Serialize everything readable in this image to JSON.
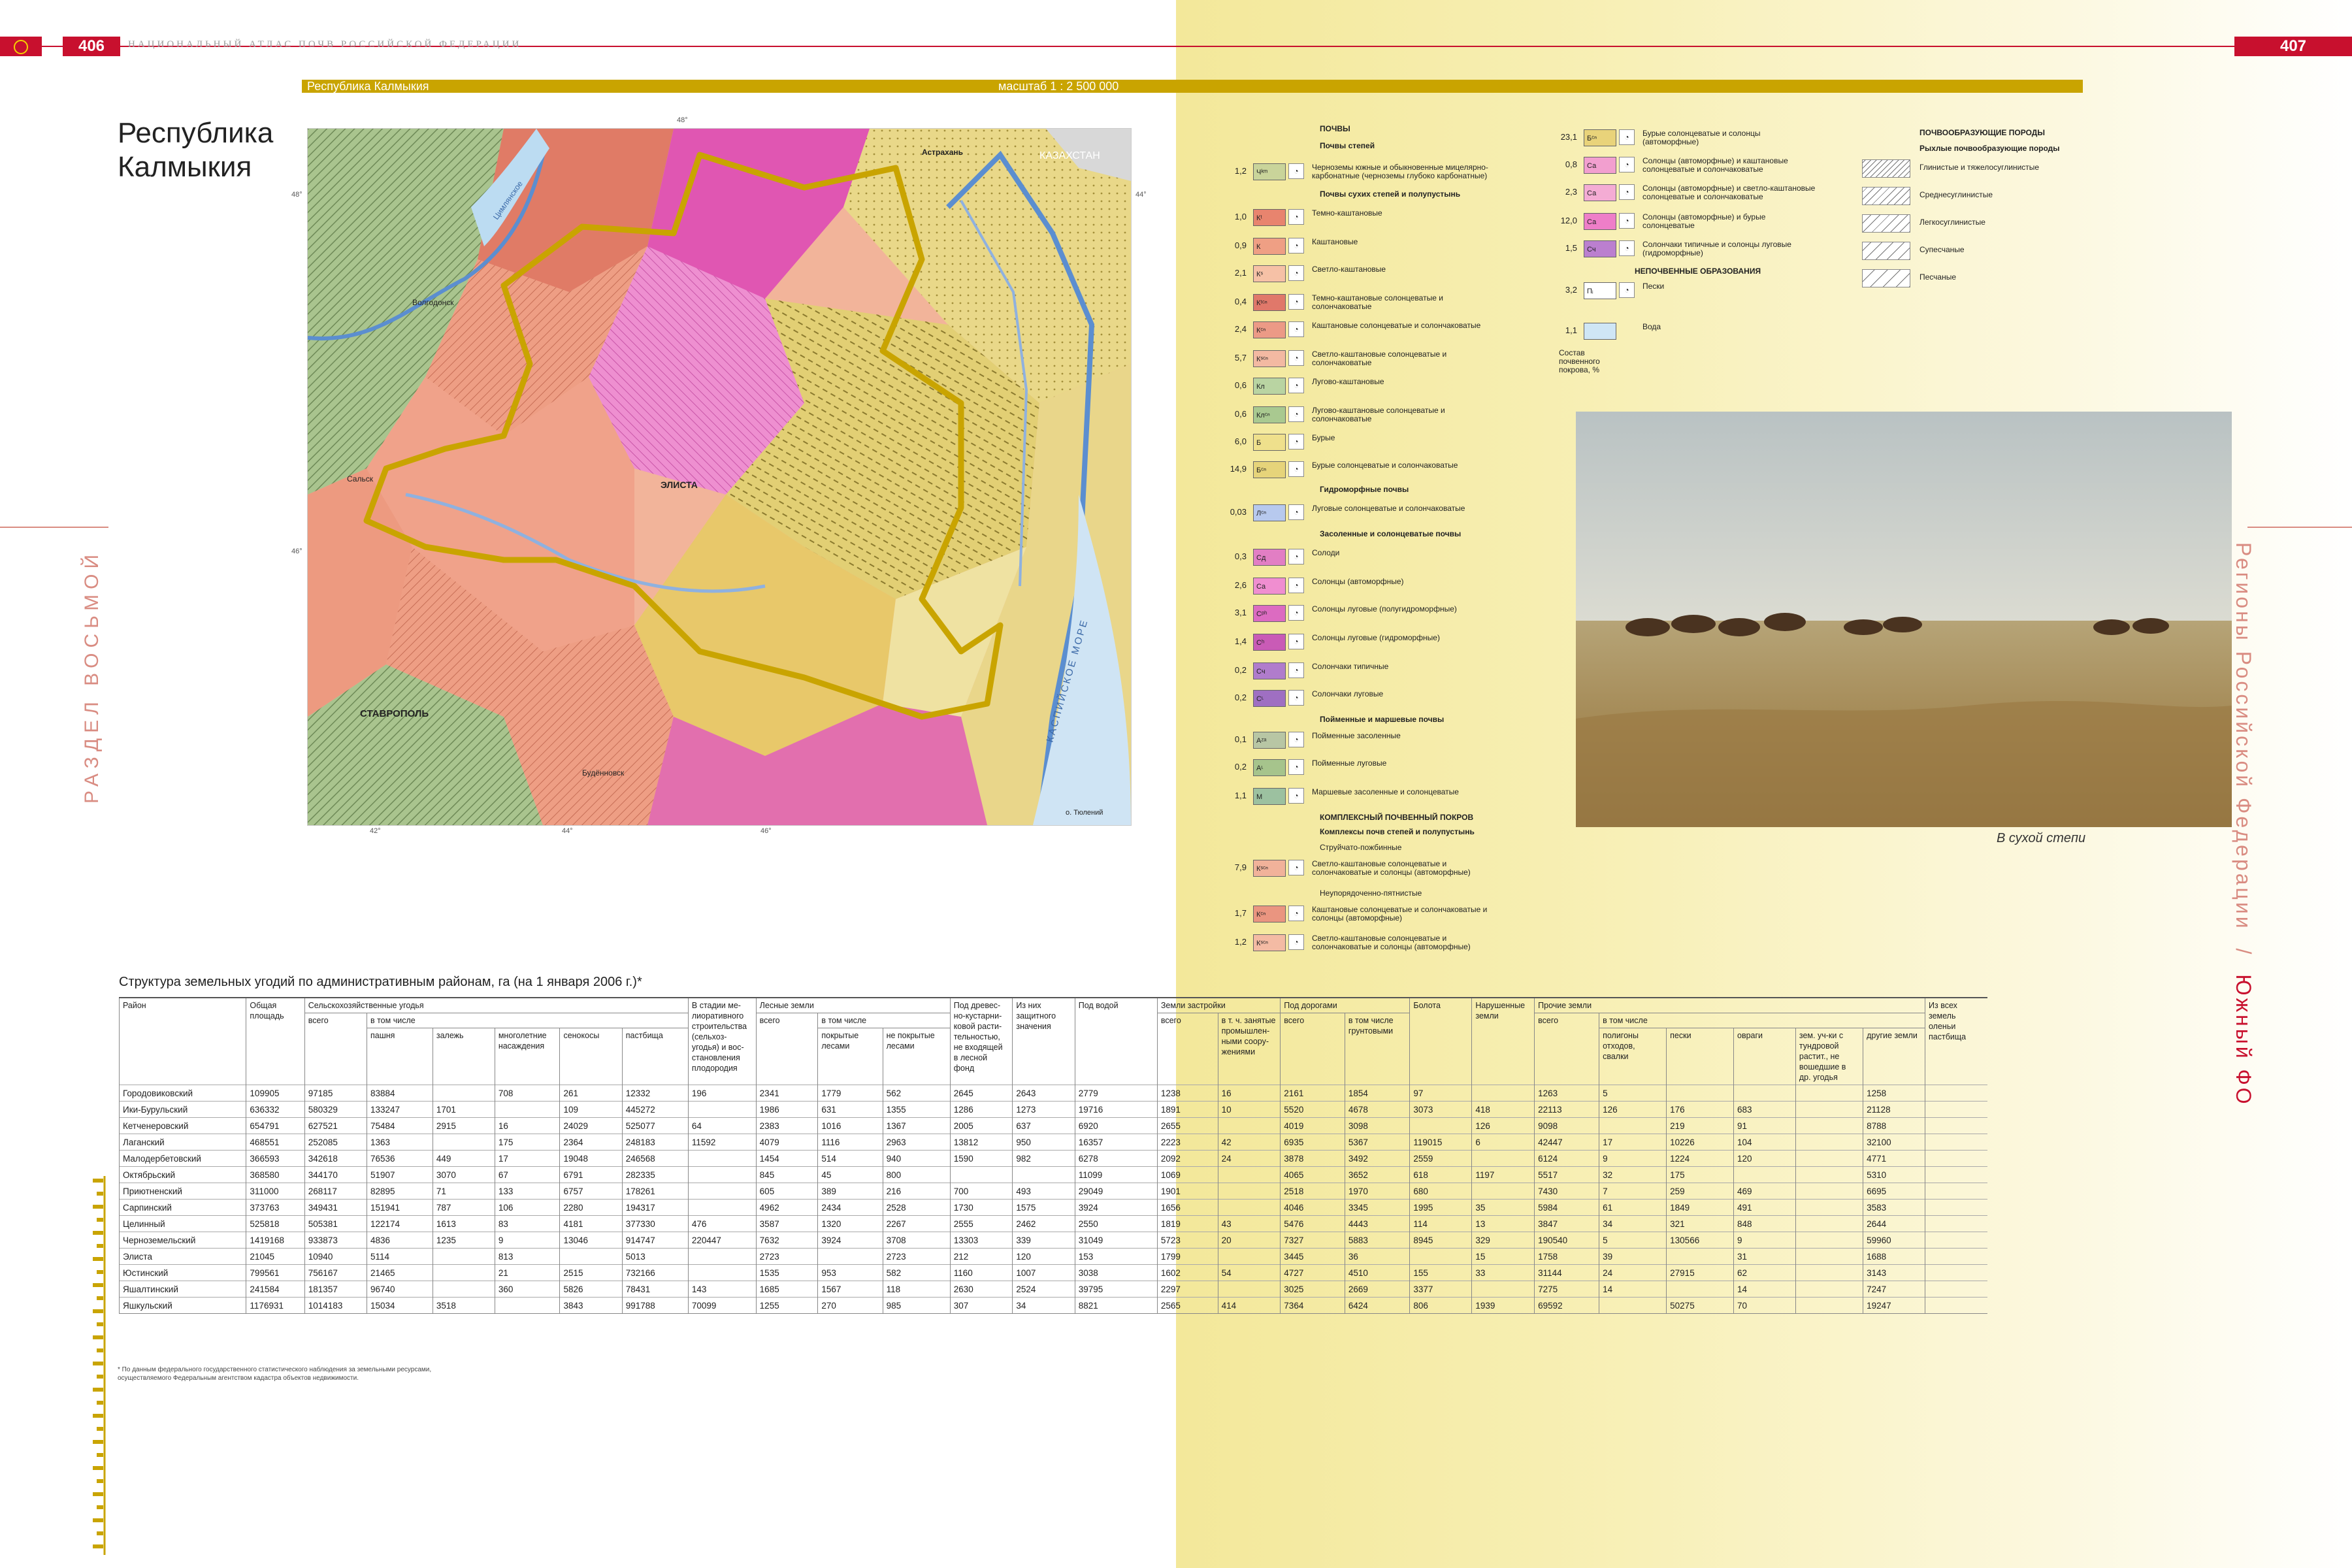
{
  "header": {
    "page_left": "406",
    "page_right": "407",
    "atlas_title": "НАЦИОНАЛЬНЫЙ АТЛАС ПОЧВ РОССИЙСКОЙ ФЕДЕРАЦИИ"
  },
  "map_bar": {
    "region": "Республика Калмыкия",
    "scale": "масштаб 1 : 2 500 000"
  },
  "title": {
    "line1": "Республика",
    "line2": "Калмыкия"
  },
  "side": {
    "left": "РАЗДЕЛ ВОСЬМОЙ",
    "right_a": "Регионы Российской Федерации",
    "sep": "/",
    "right_b": "Южный ФО"
  },
  "map_labels": {
    "kazakhstan": "КАЗАХСТАН",
    "sea": "КАСПИЙСКОЕ МОРЕ",
    "elista": "ЭЛИСТА",
    "stavropol": "СТАВРОПОЛЬ",
    "volgodonsk": "Волгодонск",
    "astrakhan": "Астрахань",
    "sal": "Сальск",
    "budennovsk": "Будённовск",
    "reservoir": "Цимлянское",
    "island": "о. Тюлений",
    "lon1": "42°",
    "lon2": "44°",
    "lon3": "46°",
    "lon4": "48°",
    "lat1": "48°",
    "lat2": "46°",
    "lat3": "44°"
  },
  "legend": {
    "col1_title": "ПОЧВЫ",
    "g_steppe": "Почвы степей",
    "g_dry": "Почвы сухих степей и полупустынь",
    "g_hydro": "Гидроморфные почвы",
    "g_saline": "Засоленные и солонцеватые почвы",
    "g_flood": "Пойменные и маршевые почвы",
    "g_complex": "КОМПЛЕКСНЫЙ ПОЧВЕННЫЙ ПОКРОВ",
    "g_complex_sub": "Комплексы почв степей и полупустынь",
    "g_stream": "Струйчато-пожбинные",
    "g_spot": "Неупорядоченно-пятнистые",
    "col2_nonsoil": "НЕПОЧВЕННЫЕ ОБРАЗОВАНИЯ",
    "composition_note": "Состав почвенного покрова, %",
    "col3_title": "ПОЧВООБРАЗУЮЩИЕ ПОРОДЫ",
    "col3_sub": "Рыхлые почвообразующие породы",
    "items1": [
      {
        "pct": "1,2",
        "code": "Чᵏᵐ",
        "color": "#c9d49a",
        "label": "Черноземы южные и обыкновенные мицелярно-карбонатные (черноземы глубоко карбонатные)"
      },
      {
        "pct": "1,0",
        "code": "Кᵗ",
        "color": "#e8846e",
        "label": "Темно-каштановые"
      },
      {
        "pct": "0,9",
        "code": "К",
        "color": "#ef9f84",
        "label": "Каштановые"
      },
      {
        "pct": "2,1",
        "code": "Кˢ",
        "color": "#f6c1a6",
        "label": "Светло-каштановые"
      },
      {
        "pct": "0,4",
        "code": "Кᵗᶜⁿ",
        "color": "#e0786a",
        "label": "Темно-каштановые солонцеватые и солончаковатые"
      },
      {
        "pct": "2,4",
        "code": "Кᶜⁿ",
        "color": "#ec9a86",
        "label": "Каштановые солонцеватые и солончаковатые"
      },
      {
        "pct": "5,7",
        "code": "Кˢᶜⁿ",
        "color": "#f3b9a2",
        "label": "Светло-каштановые солонцеватые и солончаковатые"
      },
      {
        "pct": "0,6",
        "code": "Кл",
        "color": "#b9d4a2",
        "label": "Лугово-каштановые"
      },
      {
        "pct": "0,6",
        "code": "Клᶜⁿ",
        "color": "#a9c990",
        "label": "Лугово-каштановые солонцеватые и солончаковатые"
      },
      {
        "pct": "6,0",
        "code": "Б",
        "color": "#efe08c",
        "label": "Бурые"
      },
      {
        "pct": "14,9",
        "code": "Бᶜⁿ",
        "color": "#e6d47a",
        "label": "Бурые солонцеватые и солончаковатые"
      },
      {
        "pct": "0,03",
        "code": "Лᶜⁿ",
        "color": "#b7c9ee",
        "label": "Луговые солонцеватые и солончаковатые"
      },
      {
        "pct": "0,3",
        "code": "Сд",
        "color": "#e27ec4",
        "label": "Солоди"
      },
      {
        "pct": "2,6",
        "code": "Сa",
        "color": "#f08ed0",
        "label": "Солонцы (автоморфные)"
      },
      {
        "pct": "3,1",
        "code": "Сᵖʰ",
        "color": "#dc6bc1",
        "label": "Солонцы луговые (полугидроморфные)"
      },
      {
        "pct": "1,4",
        "code": "Сʰ",
        "color": "#c95bb6",
        "label": "Солонцы луговые (гидроморфные)"
      },
      {
        "pct": "0,2",
        "code": "Сч",
        "color": "#b07ccc",
        "label": "Солончаки типичные"
      },
      {
        "pct": "0,2",
        "code": "Сᶫ",
        "color": "#9f6fc2",
        "label": "Солончаки луговые"
      },
      {
        "pct": "0,1",
        "code": "Аᶻᵃ",
        "color": "#b8c6a4",
        "label": "Пойменные засоленные"
      },
      {
        "pct": "0,2",
        "code": "Аᶫ",
        "color": "#a6c48c",
        "label": "Пойменные луговые"
      },
      {
        "pct": "1,1",
        "code": "М",
        "color": "#9cc1a0",
        "label": "Маршевые засоленные и солонцеватые"
      },
      {
        "pct": "7,9",
        "code": "Кˢᶜⁿ",
        "color": "#f1b29a",
        "label": "Светло-каштановые солонцеватые и солончаковатые и солонцы (автоморфные)"
      },
      {
        "pct": "1,7",
        "code": "Кᶜⁿ",
        "color": "#ea9580",
        "label": "Каштановые солонцеватые и солончаковатые и солонцы (автоморфные)"
      },
      {
        "pct": "1,2",
        "code": "Кˢᶜⁿ",
        "color": "#f4bba4",
        "label": "Светло-каштановые солонцеватые и солончаковатые и солонцы (автоморфные)"
      }
    ],
    "items2": [
      {
        "pct": "23,1",
        "code": "Бᶜⁿ",
        "color": "#e9d37a",
        "label": "Бурые солонцеватые и солонцы (автоморфные)"
      },
      {
        "pct": "0,8",
        "code": "Са",
        "color": "#f29fcf",
        "label": "Солонцы (автоморфные) и каштановые солонцеватые и солончаковатые"
      },
      {
        "pct": "2,3",
        "code": "Са",
        "color": "#f4acd4",
        "label": "Солонцы (автоморфные) и светло-каштановые солонцеватые и солончаковатые"
      },
      {
        "pct": "12,0",
        "code": "Са",
        "color": "#ee7ec8",
        "label": "Солонцы (автоморфные) и бурые солонцеватые"
      },
      {
        "pct": "1,5",
        "code": "Сч",
        "color": "#bb7fcf",
        "label": "Солончаки типичные и солонцы луговые (гидроморфные)"
      },
      {
        "pct": "3,2",
        "code": "Пᵢ",
        "color": "#ffffff",
        "label": "Пески"
      },
      {
        "pct": "1,1",
        "code": "",
        "color": "#cfe6f5",
        "label": "Вода"
      }
    ],
    "items3": [
      {
        "label": "Глинистые и тяжелосуглинистые"
      },
      {
        "label": "Среднесуглинистые"
      },
      {
        "label": "Легкосуглинистые"
      },
      {
        "label": "Супесчаные"
      },
      {
        "label": "Песчаные"
      }
    ]
  },
  "photo_caption": "В сухой степи",
  "table": {
    "title": "Структура земельных угодий по административным районам, га (на 1 января 2006 г.)*",
    "h": {
      "district": "Район",
      "total_area": "Общая площадь",
      "agri": "Сельскохозяйственные угодья",
      "of_which": "в том числе",
      "total": "всего",
      "arable": "пашня",
      "fallow": "залежь",
      "perennial": "многолетние насаждения",
      "hayfield": "сенокосы",
      "pasture": "пастбища",
      "melior": "В стадии ме- лиоративного строительства (сельхоз- угодья) и вос- становления плодородия",
      "forest": "Лесные земли",
      "forest_covered": "покрытые лесами",
      "forest_uncovered": "не покрытые лесами",
      "shrub": "Под древес- но-кустарни- ковой расти- тельностью, не входящей в лесной фонд",
      "protective": "Из них защитного значения",
      "water": "Под водой",
      "built": "Земли застройки",
      "industrial": "в т. ч. занятые промышлен- ными соору- жениями",
      "roads": "Под дорогами",
      "unpaved": "в том числе грунтовыми",
      "swamps": "Болота",
      "disturbed": "Нарушенные земли",
      "other": "Прочие земли",
      "landfill": "полигоны отходов, свалки",
      "sands": "пески",
      "ravines": "овраги",
      "tundra": "зем. уч-ки с тундровой растит., не вошедшие в др. угодья",
      "other_land": "другие земли",
      "deer": "Из всех земель оленьи пастбища"
    },
    "rows": [
      [
        "Городовиковский",
        "109905",
        "97185",
        "83884",
        "",
        "708",
        "261",
        "12332",
        "196",
        "2341",
        "1779",
        "562",
        "2645",
        "2643",
        "2779",
        "1238",
        "16",
        "2161",
        "1854",
        "97",
        "",
        "1263",
        "5",
        "",
        "",
        "",
        "1258",
        ""
      ],
      [
        "Ики-Бурульский",
        "636332",
        "580329",
        "133247",
        "1701",
        "",
        "109",
        "445272",
        "",
        "1986",
        "631",
        "1355",
        "1286",
        "1273",
        "19716",
        "1891",
        "10",
        "5520",
        "4678",
        "3073",
        "418",
        "22113",
        "126",
        "176",
        "683",
        "",
        "21128",
        ""
      ],
      [
        "Кетченеровский",
        "654791",
        "627521",
        "75484",
        "2915",
        "16",
        "24029",
        "525077",
        "64",
        "2383",
        "1016",
        "1367",
        "2005",
        "637",
        "6920",
        "2655",
        "",
        "4019",
        "3098",
        "",
        "126",
        "9098",
        "",
        "219",
        "91",
        "",
        "8788",
        ""
      ],
      [
        "Лаганский",
        "468551",
        "252085",
        "1363",
        "",
        "175",
        "2364",
        "248183",
        "11592",
        "4079",
        "1116",
        "2963",
        "13812",
        "950",
        "16357",
        "2223",
        "42",
        "6935",
        "5367",
        "119015",
        "6",
        "42447",
        "17",
        "10226",
        "104",
        "",
        "32100",
        ""
      ],
      [
        "Малодербетовский",
        "366593",
        "342618",
        "76536",
        "449",
        "17",
        "19048",
        "246568",
        "",
        "1454",
        "514",
        "940",
        "1590",
        "982",
        "6278",
        "2092",
        "24",
        "3878",
        "3492",
        "2559",
        "",
        "6124",
        "9",
        "1224",
        "120",
        "",
        "4771",
        ""
      ],
      [
        "Октябрьский",
        "368580",
        "344170",
        "51907",
        "3070",
        "67",
        "6791",
        "282335",
        "",
        "845",
        "45",
        "800",
        "",
        "",
        "11099",
        "1069",
        "",
        "4065",
        "3652",
        "618",
        "1197",
        "5517",
        "32",
        "175",
        "",
        "",
        "5310",
        ""
      ],
      [
        "Приютненский",
        "311000",
        "268117",
        "82895",
        "71",
        "133",
        "6757",
        "178261",
        "",
        "605",
        "389",
        "216",
        "700",
        "493",
        "29049",
        "1901",
        "",
        "2518",
        "1970",
        "680",
        "",
        "7430",
        "7",
        "259",
        "469",
        "",
        "6695",
        ""
      ],
      [
        "Сарпинский",
        "373763",
        "349431",
        "151941",
        "787",
        "106",
        "2280",
        "194317",
        "",
        "4962",
        "2434",
        "2528",
        "1730",
        "1575",
        "3924",
        "1656",
        "",
        "4046",
        "3345",
        "1995",
        "35",
        "5984",
        "61",
        "1849",
        "491",
        "",
        "3583",
        ""
      ],
      [
        "Целинный",
        "525818",
        "505381",
        "122174",
        "1613",
        "83",
        "4181",
        "377330",
        "476",
        "3587",
        "1320",
        "2267",
        "2555",
        "2462",
        "2550",
        "1819",
        "43",
        "5476",
        "4443",
        "114",
        "13",
        "3847",
        "34",
        "321",
        "848",
        "",
        "2644",
        ""
      ],
      [
        "Черноземельский",
        "1419168",
        "933873",
        "4836",
        "1235",
        "9",
        "13046",
        "914747",
        "220447",
        "7632",
        "3924",
        "3708",
        "13303",
        "339",
        "31049",
        "5723",
        "20",
        "7327",
        "5883",
        "8945",
        "329",
        "190540",
        "5",
        "130566",
        "9",
        "",
        "59960",
        ""
      ],
      [
        "Элиста",
        "21045",
        "10940",
        "5114",
        "",
        "813",
        "",
        "5013",
        "",
        "2723",
        "",
        "2723",
        "212",
        "120",
        "153",
        "1799",
        "",
        "3445",
        "36",
        "",
        "15",
        "1758",
        "39",
        "",
        "31",
        "",
        "1688",
        ""
      ],
      [
        "Юстинский",
        "799561",
        "756167",
        "21465",
        "",
        "21",
        "2515",
        "732166",
        "",
        "1535",
        "953",
        "582",
        "1160",
        "1007",
        "3038",
        "1602",
        "54",
        "4727",
        "4510",
        "155",
        "33",
        "31144",
        "24",
        "27915",
        "62",
        "",
        "3143",
        ""
      ],
      [
        "Яшалтинский",
        "241584",
        "181357",
        "96740",
        "",
        "360",
        "5826",
        "78431",
        "143",
        "1685",
        "1567",
        "118",
        "2630",
        "2524",
        "39795",
        "2297",
        "",
        "3025",
        "2669",
        "3377",
        "",
        "7275",
        "14",
        "",
        "14",
        "",
        "7247",
        ""
      ],
      [
        "Яшкульский",
        "1176931",
        "1014183",
        "15034",
        "3518",
        "",
        "3843",
        "991788",
        "70099",
        "1255",
        "270",
        "985",
        "307",
        "34",
        "8821",
        "2565",
        "414",
        "7364",
        "6424",
        "806",
        "1939",
        "69592",
        "",
        "50275",
        "70",
        "",
        "19247",
        ""
      ]
    ]
  },
  "footnote": "* По данным федерального государственного статистического наблюдения за земельными ресурсами, осуществляемого Федеральным агентством кадастра объектов недвижимости."
}
